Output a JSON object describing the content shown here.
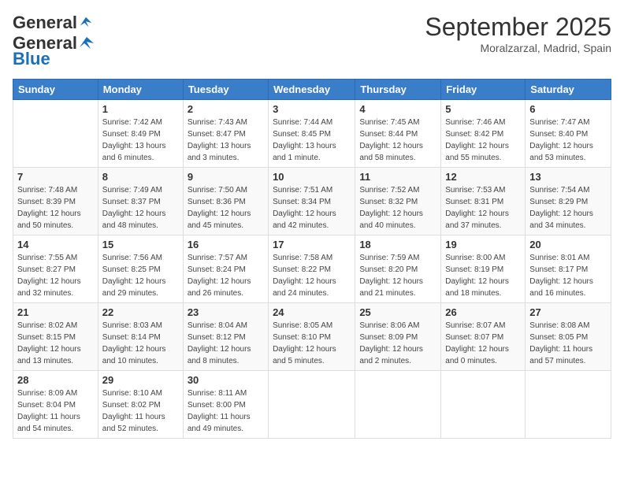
{
  "header": {
    "logo_general": "General",
    "logo_blue": "Blue",
    "month_title": "September 2025",
    "location": "Moralzarzal, Madrid, Spain"
  },
  "days_of_week": [
    "Sunday",
    "Monday",
    "Tuesday",
    "Wednesday",
    "Thursday",
    "Friday",
    "Saturday"
  ],
  "weeks": [
    [
      {
        "day": "",
        "sunrise": "",
        "sunset": "",
        "daylight": ""
      },
      {
        "day": "1",
        "sunrise": "Sunrise: 7:42 AM",
        "sunset": "Sunset: 8:49 PM",
        "daylight": "Daylight: 13 hours and 6 minutes."
      },
      {
        "day": "2",
        "sunrise": "Sunrise: 7:43 AM",
        "sunset": "Sunset: 8:47 PM",
        "daylight": "Daylight: 13 hours and 3 minutes."
      },
      {
        "day": "3",
        "sunrise": "Sunrise: 7:44 AM",
        "sunset": "Sunset: 8:45 PM",
        "daylight": "Daylight: 13 hours and 1 minute."
      },
      {
        "day": "4",
        "sunrise": "Sunrise: 7:45 AM",
        "sunset": "Sunset: 8:44 PM",
        "daylight": "Daylight: 12 hours and 58 minutes."
      },
      {
        "day": "5",
        "sunrise": "Sunrise: 7:46 AM",
        "sunset": "Sunset: 8:42 PM",
        "daylight": "Daylight: 12 hours and 55 minutes."
      },
      {
        "day": "6",
        "sunrise": "Sunrise: 7:47 AM",
        "sunset": "Sunset: 8:40 PM",
        "daylight": "Daylight: 12 hours and 53 minutes."
      }
    ],
    [
      {
        "day": "7",
        "sunrise": "Sunrise: 7:48 AM",
        "sunset": "Sunset: 8:39 PM",
        "daylight": "Daylight: 12 hours and 50 minutes."
      },
      {
        "day": "8",
        "sunrise": "Sunrise: 7:49 AM",
        "sunset": "Sunset: 8:37 PM",
        "daylight": "Daylight: 12 hours and 48 minutes."
      },
      {
        "day": "9",
        "sunrise": "Sunrise: 7:50 AM",
        "sunset": "Sunset: 8:36 PM",
        "daylight": "Daylight: 12 hours and 45 minutes."
      },
      {
        "day": "10",
        "sunrise": "Sunrise: 7:51 AM",
        "sunset": "Sunset: 8:34 PM",
        "daylight": "Daylight: 12 hours and 42 minutes."
      },
      {
        "day": "11",
        "sunrise": "Sunrise: 7:52 AM",
        "sunset": "Sunset: 8:32 PM",
        "daylight": "Daylight: 12 hours and 40 minutes."
      },
      {
        "day": "12",
        "sunrise": "Sunrise: 7:53 AM",
        "sunset": "Sunset: 8:31 PM",
        "daylight": "Daylight: 12 hours and 37 minutes."
      },
      {
        "day": "13",
        "sunrise": "Sunrise: 7:54 AM",
        "sunset": "Sunset: 8:29 PM",
        "daylight": "Daylight: 12 hours and 34 minutes."
      }
    ],
    [
      {
        "day": "14",
        "sunrise": "Sunrise: 7:55 AM",
        "sunset": "Sunset: 8:27 PM",
        "daylight": "Daylight: 12 hours and 32 minutes."
      },
      {
        "day": "15",
        "sunrise": "Sunrise: 7:56 AM",
        "sunset": "Sunset: 8:25 PM",
        "daylight": "Daylight: 12 hours and 29 minutes."
      },
      {
        "day": "16",
        "sunrise": "Sunrise: 7:57 AM",
        "sunset": "Sunset: 8:24 PM",
        "daylight": "Daylight: 12 hours and 26 minutes."
      },
      {
        "day": "17",
        "sunrise": "Sunrise: 7:58 AM",
        "sunset": "Sunset: 8:22 PM",
        "daylight": "Daylight: 12 hours and 24 minutes."
      },
      {
        "day": "18",
        "sunrise": "Sunrise: 7:59 AM",
        "sunset": "Sunset: 8:20 PM",
        "daylight": "Daylight: 12 hours and 21 minutes."
      },
      {
        "day": "19",
        "sunrise": "Sunrise: 8:00 AM",
        "sunset": "Sunset: 8:19 PM",
        "daylight": "Daylight: 12 hours and 18 minutes."
      },
      {
        "day": "20",
        "sunrise": "Sunrise: 8:01 AM",
        "sunset": "Sunset: 8:17 PM",
        "daylight": "Daylight: 12 hours and 16 minutes."
      }
    ],
    [
      {
        "day": "21",
        "sunrise": "Sunrise: 8:02 AM",
        "sunset": "Sunset: 8:15 PM",
        "daylight": "Daylight: 12 hours and 13 minutes."
      },
      {
        "day": "22",
        "sunrise": "Sunrise: 8:03 AM",
        "sunset": "Sunset: 8:14 PM",
        "daylight": "Daylight: 12 hours and 10 minutes."
      },
      {
        "day": "23",
        "sunrise": "Sunrise: 8:04 AM",
        "sunset": "Sunset: 8:12 PM",
        "daylight": "Daylight: 12 hours and 8 minutes."
      },
      {
        "day": "24",
        "sunrise": "Sunrise: 8:05 AM",
        "sunset": "Sunset: 8:10 PM",
        "daylight": "Daylight: 12 hours and 5 minutes."
      },
      {
        "day": "25",
        "sunrise": "Sunrise: 8:06 AM",
        "sunset": "Sunset: 8:09 PM",
        "daylight": "Daylight: 12 hours and 2 minutes."
      },
      {
        "day": "26",
        "sunrise": "Sunrise: 8:07 AM",
        "sunset": "Sunset: 8:07 PM",
        "daylight": "Daylight: 12 hours and 0 minutes."
      },
      {
        "day": "27",
        "sunrise": "Sunrise: 8:08 AM",
        "sunset": "Sunset: 8:05 PM",
        "daylight": "Daylight: 11 hours and 57 minutes."
      }
    ],
    [
      {
        "day": "28",
        "sunrise": "Sunrise: 8:09 AM",
        "sunset": "Sunset: 8:04 PM",
        "daylight": "Daylight: 11 hours and 54 minutes."
      },
      {
        "day": "29",
        "sunrise": "Sunrise: 8:10 AM",
        "sunset": "Sunset: 8:02 PM",
        "daylight": "Daylight: 11 hours and 52 minutes."
      },
      {
        "day": "30",
        "sunrise": "Sunrise: 8:11 AM",
        "sunset": "Sunset: 8:00 PM",
        "daylight": "Daylight: 11 hours and 49 minutes."
      },
      {
        "day": "",
        "sunrise": "",
        "sunset": "",
        "daylight": ""
      },
      {
        "day": "",
        "sunrise": "",
        "sunset": "",
        "daylight": ""
      },
      {
        "day": "",
        "sunrise": "",
        "sunset": "",
        "daylight": ""
      },
      {
        "day": "",
        "sunrise": "",
        "sunset": "",
        "daylight": ""
      }
    ]
  ]
}
